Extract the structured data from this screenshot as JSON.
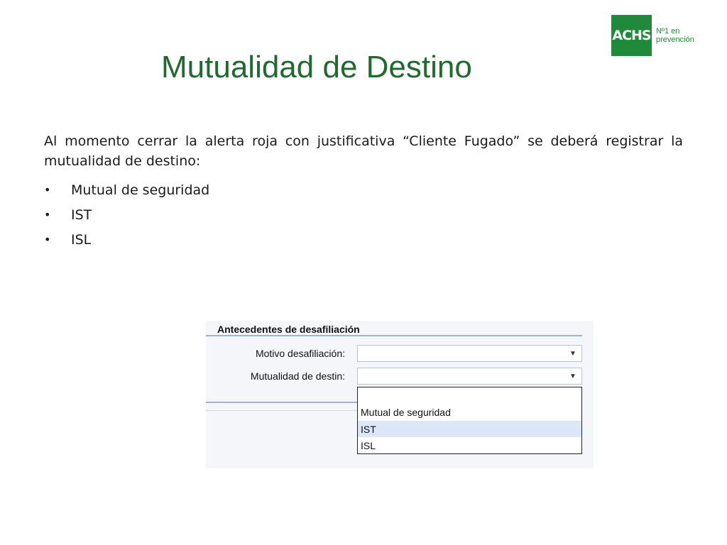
{
  "logo": {
    "brand": "ACHS",
    "tagline_1": "Nº1 en",
    "tagline_2": "prevención"
  },
  "slide": {
    "title": "Mutualidad de Destino",
    "body": "Al momento cerrar la alerta roja con justificativa “Cliente Fugado” se deberá registrar la mutualidad de destino:",
    "bullet_char": "•",
    "bullets": [
      "Mutual de seguridad",
      "IST",
      "ISL"
    ]
  },
  "form": {
    "section_title": "Antecedentes de desafiliación",
    "motivo_label": "Motivo desafiliación:",
    "motivo_value": "",
    "mutualidad_label": "Mutualidad de destin:",
    "mutualidad_value": "",
    "arrow": "▼",
    "options": [
      "",
      "Mutual de seguridad",
      "IST",
      "ISL"
    ],
    "highlighted_option": "IST"
  },
  "colors": {
    "brand_green": "#1e8a3a",
    "title_green": "#1f6b2e",
    "highlight": "#dbe6f7",
    "border_blue": "#9ab3d8"
  }
}
